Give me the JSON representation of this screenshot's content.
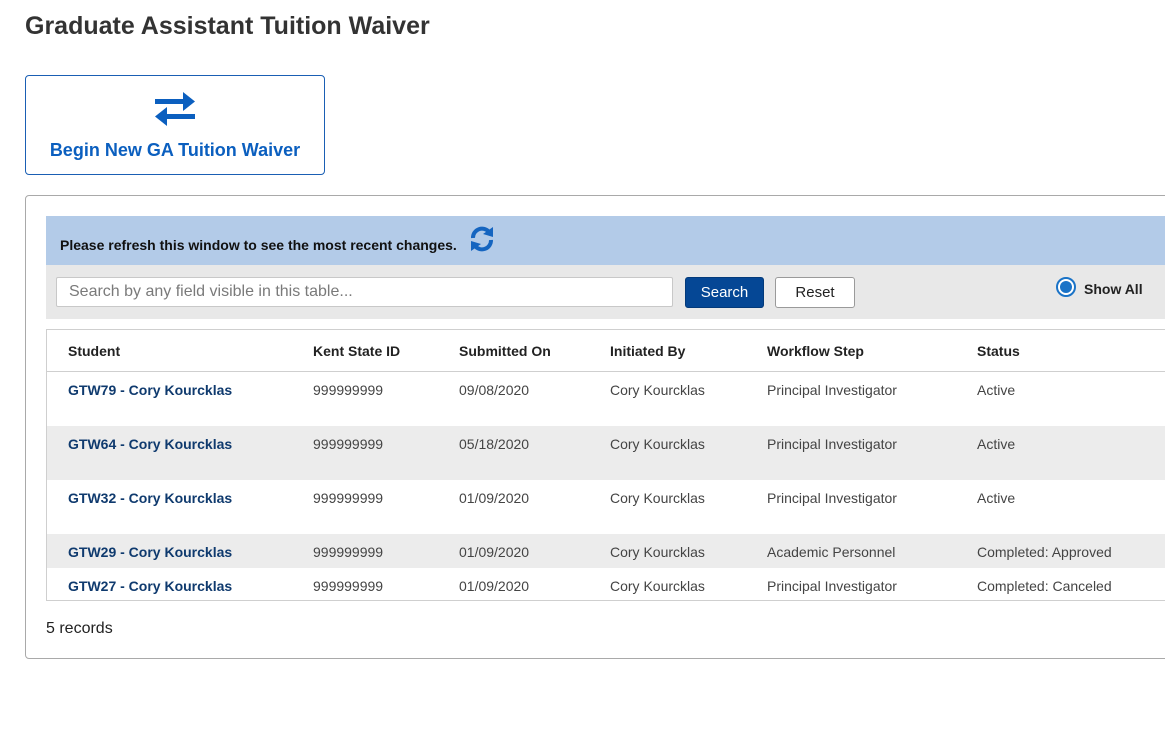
{
  "page": {
    "title": "Graduate Assistant Tuition Waiver"
  },
  "begin_card": {
    "label": "Begin New GA Tuition Waiver",
    "icon": "swap-arrows-icon",
    "color": "#0b5fbf"
  },
  "refresh_bar": {
    "message": "Please refresh this window to see the most recent changes.",
    "icon": "refresh-icon"
  },
  "search": {
    "placeholder": "Search by any field visible in this table...",
    "value": "",
    "search_label": "Search",
    "reset_label": "Reset",
    "show_all_label": "Show All",
    "show_all_selected": true
  },
  "table": {
    "headers": [
      "Student",
      "Kent State ID",
      "Submitted On",
      "Initiated By",
      "Workflow Step",
      "Status"
    ],
    "rows": [
      {
        "student": "GTW79 - Cory Kourcklas",
        "kent_id": "999999999",
        "submitted": "09/08/2020",
        "initiated_by": "Cory Kourcklas",
        "workflow": "Principal Investigator",
        "status": "Active"
      },
      {
        "student": "GTW64 - Cory Kourcklas",
        "kent_id": "999999999",
        "submitted": "05/18/2020",
        "initiated_by": "Cory Kourcklas",
        "workflow": "Principal Investigator",
        "status": "Active"
      },
      {
        "student": "GTW32 - Cory Kourcklas",
        "kent_id": "999999999",
        "submitted": "01/09/2020",
        "initiated_by": "Cory Kourcklas",
        "workflow": "Principal Investigator",
        "status": "Active"
      },
      {
        "student": "GTW29 - Cory Kourcklas",
        "kent_id": "999999999",
        "submitted": "01/09/2020",
        "initiated_by": "Cory Kourcklas",
        "workflow": "Academic Personnel",
        "status": "Completed: Approved"
      },
      {
        "student": "GTW27 - Cory Kourcklas",
        "kent_id": "999999999",
        "submitted": "01/09/2020",
        "initiated_by": "Cory Kourcklas",
        "workflow": "Principal Investigator",
        "status": "Completed: Canceled"
      }
    ]
  },
  "footer": {
    "record_count": "5 records"
  },
  "colors": {
    "accent": "#054795",
    "refresh_bar": "#b3cbe8",
    "link": "#0f3a6e"
  }
}
